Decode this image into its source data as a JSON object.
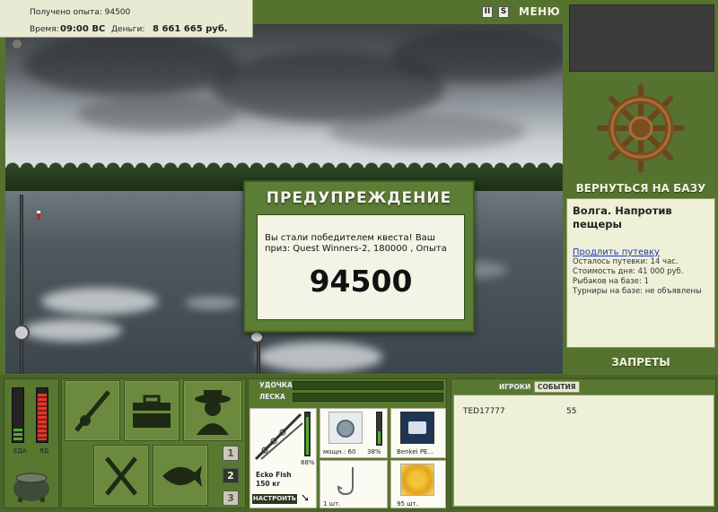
{
  "info": {
    "experience_label": "Получено опыта:",
    "experience_value": "94500",
    "time_label": "Время:",
    "time_value": "09:00 ВС",
    "money_label": "Деньги:",
    "money_value": "8 661 665 руб."
  },
  "toolbar": {
    "pause_label": "II",
    "sound_label": "S",
    "menu_label": "МЕНЮ"
  },
  "right_panel": {
    "return_label": "ВЕРНУТЬСЯ НА БАЗУ",
    "location_name": "Волга. Напротив пещеры",
    "extend_link": "Продлить путевку",
    "stats": [
      "Осталось путевки: 14 час.",
      "Стоимость дня: 41 000 руб.",
      "Рыбаков на базе: 1",
      "Турниры на базе: не объявлены"
    ],
    "bans_label": "ЗАПРЕТЫ"
  },
  "dialog": {
    "title": "ПРЕДУПРЕЖДЕНИЕ",
    "message": "Вы стали победителем квеста! Ваш приз: Quest Winners-2, 180000 , Опыта",
    "amount": "94500"
  },
  "status": {
    "food_label": "ЕДА",
    "poison_label": "ЯД",
    "food_level": 0.3,
    "poison_level": 1.0
  },
  "slots": [
    "1",
    "2",
    "3"
  ],
  "tackle": {
    "rod_label": "УДОЧКА",
    "line_label": "ЛЕСКА",
    "rod_name": "Ecko Fish",
    "rod_weight": "150 кг",
    "rod_percent": "88%",
    "reel_power": "мощн.: 60",
    "reel_percent": "38%",
    "line_name": "Benkei PE...",
    "hook_count": "1 шт.",
    "bait_count": "95 шт.",
    "setup_label": "НАСТРОИТЬ"
  },
  "players": {
    "tab_players": "ИГРОКИ",
    "tab_events": "СОБЫТИЯ",
    "rows": [
      {
        "name": "TED17777",
        "value": "55"
      }
    ]
  },
  "colors": {
    "panel_green": "#55722f",
    "meter_green": "#4caf2f",
    "meter_red": "#e0382a"
  }
}
